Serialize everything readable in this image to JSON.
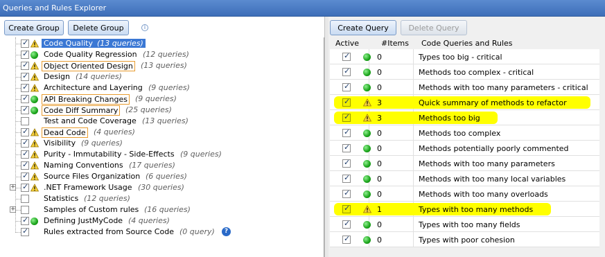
{
  "window": {
    "title": "Queries and Rules Explorer"
  },
  "toolbar_left": {
    "create_group": "Create Group",
    "delete_group": "Delete Group"
  },
  "toolbar_right": {
    "create_query": "Create Query",
    "delete_query": "Delete Query"
  },
  "tree": [
    {
      "label": "Code Quality",
      "count": "(13 queries)",
      "status": "warn",
      "selected": true,
      "boxed": false,
      "checked": true
    },
    {
      "label": "Code Quality Regression",
      "count": "(12 queries)",
      "status": "ok",
      "selected": false,
      "boxed": false,
      "checked": true
    },
    {
      "label": "Object Oriented Design",
      "count": "(13 queries)",
      "status": "warn",
      "selected": false,
      "boxed": true,
      "checked": true
    },
    {
      "label": "Design",
      "count": "(14 queries)",
      "status": "warn",
      "selected": false,
      "boxed": false,
      "checked": true
    },
    {
      "label": "Architecture and Layering",
      "count": "(9 queries)",
      "status": "warn",
      "selected": false,
      "boxed": false,
      "checked": true
    },
    {
      "label": "API Breaking Changes",
      "count": "(9 queries)",
      "status": "ok",
      "selected": false,
      "boxed": true,
      "checked": true
    },
    {
      "label": "Code Diff Summary",
      "count": "(25 queries)",
      "status": "ok",
      "selected": false,
      "boxed": true,
      "checked": true
    },
    {
      "label": "Test and Code Coverage",
      "count": "(13 queries)",
      "status": "none",
      "selected": false,
      "boxed": false,
      "checked": false
    },
    {
      "label": "Dead Code",
      "count": "(4 queries)",
      "status": "warn",
      "selected": false,
      "boxed": true,
      "checked": true
    },
    {
      "label": "Visibility",
      "count": "(9 queries)",
      "status": "warn",
      "selected": false,
      "boxed": false,
      "checked": true
    },
    {
      "label": "Purity - Immutability - Side-Effects",
      "count": "(9 queries)",
      "status": "warn",
      "selected": false,
      "boxed": false,
      "checked": true
    },
    {
      "label": "Naming Conventions",
      "count": "(17 queries)",
      "status": "warn",
      "selected": false,
      "boxed": false,
      "checked": true
    },
    {
      "label": "Source Files Organization",
      "count": "(6 queries)",
      "status": "warn",
      "selected": false,
      "boxed": false,
      "checked": true
    },
    {
      "label": ".NET Framework Usage",
      "count": "(30 queries)",
      "status": "warn",
      "selected": false,
      "boxed": false,
      "checked": true,
      "expander": true
    },
    {
      "label": "Statistics",
      "count": "(12 queries)",
      "status": "none",
      "selected": false,
      "boxed": false,
      "checked": false
    },
    {
      "label": "Samples of Custom rules",
      "count": "(16 queries)",
      "status": "none",
      "selected": false,
      "boxed": false,
      "checked": false,
      "expander": true
    },
    {
      "label": "Defining JustMyCode",
      "count": "(4 queries)",
      "status": "ok",
      "selected": false,
      "boxed": false,
      "checked": true
    },
    {
      "label": "Rules extracted from Source Code",
      "count": "(0 query)",
      "status": "none",
      "selected": false,
      "boxed": false,
      "checked": true,
      "help": true
    }
  ],
  "grid": {
    "headers": {
      "active": "Active",
      "items": "#Items",
      "name": "Code Queries and Rules"
    },
    "rows": [
      {
        "status": "ok",
        "items": "0",
        "name": "Types too big - critical",
        "highlight": false
      },
      {
        "status": "ok",
        "items": "0",
        "name": "Methods too complex - critical",
        "highlight": false
      },
      {
        "status": "ok",
        "items": "0",
        "name": "Methods with too many parameters - critical",
        "highlight": false
      },
      {
        "status": "warn",
        "items": "3",
        "name": "Quick summary of methods to refactor",
        "highlight": true
      },
      {
        "status": "warn",
        "items": "3",
        "name": "Methods too big",
        "highlight": true
      },
      {
        "status": "ok",
        "items": "0",
        "name": "Methods too complex",
        "highlight": false
      },
      {
        "status": "ok",
        "items": "0",
        "name": "Methods potentially poorly commented",
        "highlight": false
      },
      {
        "status": "ok",
        "items": "0",
        "name": "Methods with too many parameters",
        "highlight": false
      },
      {
        "status": "ok",
        "items": "0",
        "name": "Methods with too many local variables",
        "highlight": false
      },
      {
        "status": "ok",
        "items": "0",
        "name": "Methods with too many overloads",
        "highlight": false
      },
      {
        "status": "warn",
        "items": "1",
        "name": "Types with too many methods",
        "highlight": true
      },
      {
        "status": "ok",
        "items": "0",
        "name": "Types with too many fields",
        "highlight": false
      },
      {
        "status": "ok",
        "items": "0",
        "name": "Types with poor cohesion",
        "highlight": false
      }
    ]
  },
  "colors": {
    "selection": "#3b78d4",
    "highlight": "#ffff00",
    "boxed_border": "#e89b2e",
    "ok": "#1aa31a"
  }
}
